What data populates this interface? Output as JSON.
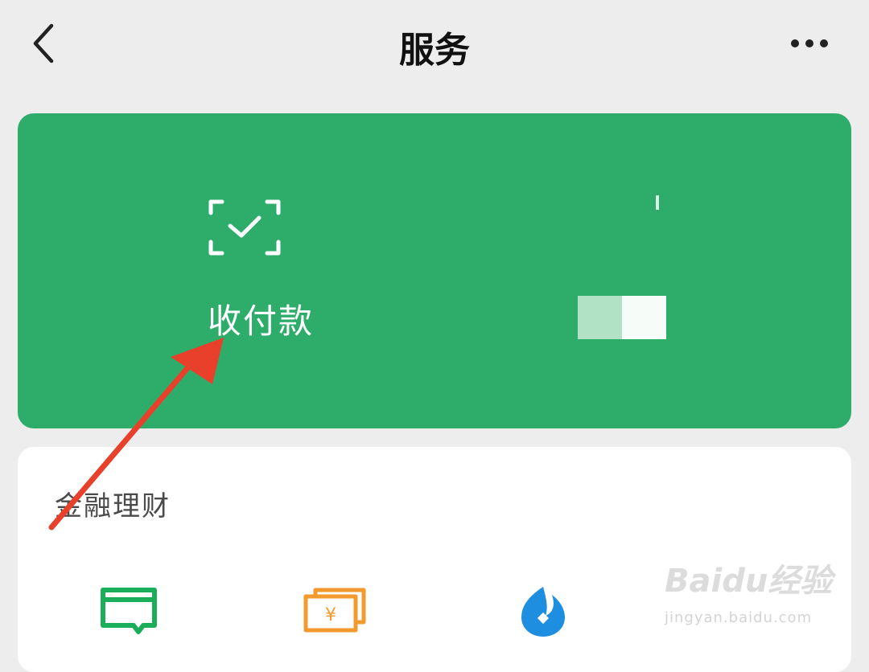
{
  "header": {
    "title": "服务",
    "back_icon": "chevron-left-icon",
    "more_icon": "more-horizontal-icon"
  },
  "payment_card": {
    "pay_label": "收付款",
    "pay_icon": "scan-check-icon",
    "background": "#2ead6a"
  },
  "finance_section": {
    "title": "金融理财",
    "items": [
      {
        "icon": "credit-card-icon",
        "color": "#1aad5a"
      },
      {
        "icon": "yuan-wallet-icon",
        "color": "#f29a2e"
      },
      {
        "icon": "wealth-drop-icon",
        "color": "#1e8fe0"
      }
    ]
  },
  "annotation": {
    "arrow_color": "#e8402a"
  },
  "watermark": {
    "main": "Baidu经验",
    "url": "jingyan.baidu.com"
  }
}
